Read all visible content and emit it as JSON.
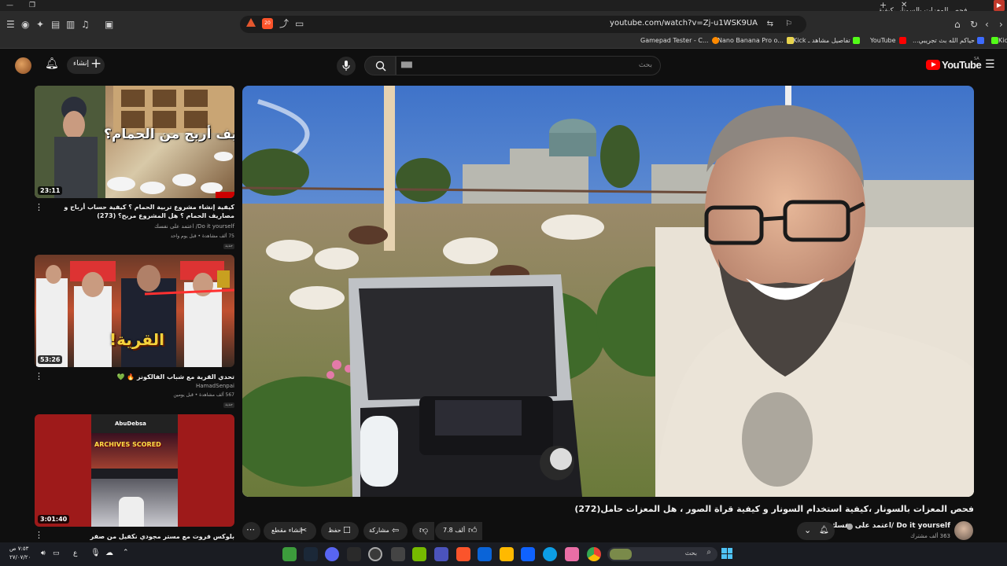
{
  "browser": {
    "tab_title": "فحص المعزات بالسونار ،كيفية...",
    "url": "youtube.com/watch?v=Zj-u1WSK9UA",
    "shield_count": "20",
    "bookmarks": [
      {
        "label": "Kick",
        "color": "#53fc18"
      },
      {
        "label": "حياكم الله بث تجريبي...",
        "color": "#3d6bff"
      },
      {
        "label": "YouTube",
        "color": "#ff0000"
      },
      {
        "label": "تفاصيل مشاهد ـ Kick",
        "color": "#53fc18"
      },
      {
        "label": "Nano Banana Pro o...",
        "color": "#e8d44d"
      },
      {
        "label": "Gamepad Tester - C...",
        "color": "#ff8a00"
      }
    ]
  },
  "yt": {
    "logo": "YouTube",
    "region": "SA",
    "search_placeholder": "بحث",
    "search_typed": "▆▆",
    "create_label": "إنشاء"
  },
  "sidebar": [
    {
      "duration": "23:11",
      "thumb_text": "كيف أربح من الحمام؟",
      "title": "كيفية إنشاء مشروع تربية الحمام ؟ كيفية حساب أرباح و مصاريف الحمام ؟ هل المشروع مربح؟ (273)",
      "channel": "Do it yourself/ اعتمد على نفسك",
      "meta": "75 ألف مشاهدة • قبل يوم واحد",
      "badge": "جديد"
    },
    {
      "duration": "53:26",
      "thumb_text": "القرية!",
      "title": "تحدي القرية مع شباب الفالكونز 🔥 💚",
      "channel": "HamadSenpai",
      "meta": "567 ألف مشاهدة • قبل يومين",
      "badge": "جديد"
    },
    {
      "duration": "3:01:40",
      "thumb_text": "ARCHIVES SCORED",
      "thumb_sub": "AbuDebsa",
      "title": "بلوكس فروت مع مستر مجودي نكفيل من صفر",
      "channel": "",
      "meta": "",
      "badge": ""
    }
  ],
  "main": {
    "title": "فحص المعزات بالسونار ،كيفية استخدام السونار و كيفية قراة الصور ، هل المعزات حامل(272)",
    "channel": "Do it yourself /اعتمد على نفسك",
    "subs": "363 ألف مشترك",
    "likes": "7.8 ألف",
    "share": "مشاركة",
    "save": "حفظ",
    "clip": "إنشاء مقطع"
  },
  "taskbar": {
    "time": "٧:٥٣ ص",
    "date": "٢٧/٠٧/٢٠",
    "lang": "ع",
    "search": "بحث"
  },
  "colors": {
    "yt_red": "#ff0000",
    "bg": "#0f0f0f",
    "chip": "#272727"
  }
}
